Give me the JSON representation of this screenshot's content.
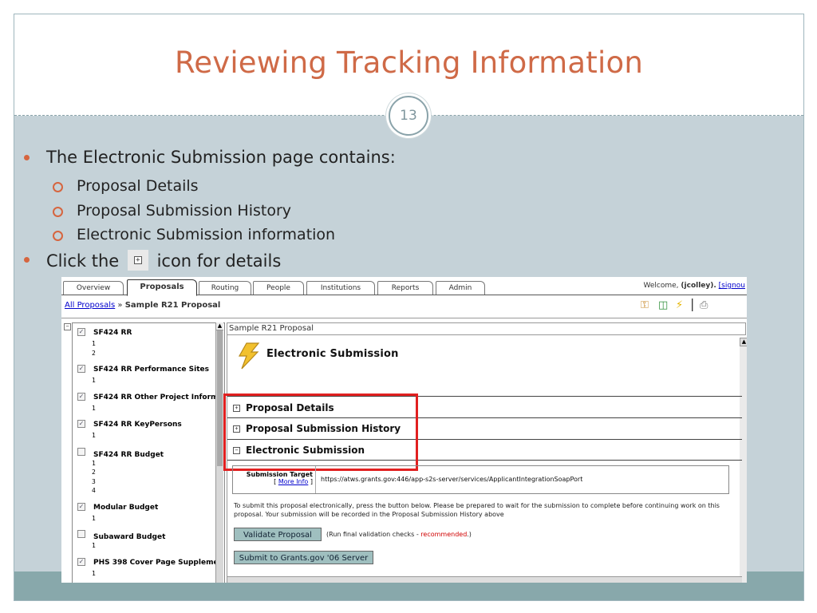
{
  "slide": {
    "title": "Reviewing Tracking Information",
    "number": "13",
    "bullets": [
      "The Electronic Submission page contains:",
      "Click the",
      "icon for details"
    ],
    "sub_bullets": [
      "Proposal Details",
      "Proposal Submission History",
      "Electronic Submission information"
    ],
    "colors": {
      "title": "#cf6a47",
      "bullet": "#d6653f",
      "footer": "#88a8ab",
      "body_bg": "#c5d2d8",
      "highlight": "#e12020"
    }
  },
  "app": {
    "tabs": [
      "Overview",
      "Proposals",
      "Routing",
      "People",
      "Institutions",
      "Reports",
      "Admin"
    ],
    "active_tab": "Proposals",
    "welcome_prefix": "Welcome, ",
    "user": "(jcolley).",
    "signout": "[signou",
    "breadcrumb": {
      "link": "All Proposals",
      "sep": "»",
      "current": "Sample R21 Proposal"
    },
    "toolbar_icons": [
      "key-icon",
      "document-arrow-icon",
      "bolt-icon",
      "print-icon"
    ]
  },
  "tree": {
    "items": [
      {
        "label": "SF424 RR",
        "checked": true,
        "subs": [
          "1",
          "2"
        ]
      },
      {
        "label": "SF424 RR Performance Sites",
        "checked": true,
        "subs": [
          "1"
        ]
      },
      {
        "label": "SF424 RR Other Project Inform",
        "checked": true,
        "subs": [
          "1"
        ]
      },
      {
        "label": "SF424 RR KeyPersons",
        "checked": true,
        "subs": [
          "1"
        ]
      },
      {
        "label": "SF424 RR Budget",
        "checked": false,
        "subs": [
          "1",
          "2",
          "3",
          "4"
        ]
      },
      {
        "label": "Modular Budget",
        "checked": true,
        "subs": [
          "1"
        ]
      },
      {
        "label": "Subaward Budget",
        "checked": false,
        "subs": [
          "1"
        ]
      },
      {
        "label": "PHS 398 Cover Page Supplemer",
        "checked": true,
        "subs": [
          "1"
        ]
      }
    ]
  },
  "panel": {
    "header": "Sample R21 Proposal",
    "title": "Electronic Submission",
    "sections": [
      "Proposal Details",
      "Proposal Submission History",
      "Electronic Submission"
    ],
    "target_label": "Submission Target",
    "more_info": "More Info",
    "target_url": "https://atws.grants.gov:446/app-s2s-server/services/ApplicantIntegrationSoapPort",
    "instructions": "To submit this proposal electronically, press the button below. Please be prepared to wait for the submission to complete before continuing work on this proposal. Your submission will be recorded in the Proposal Submission History above",
    "validate_button": "Validate Proposal",
    "validate_note": "(Run final validation checks - ",
    "validate_note_rec": "recommended",
    "validate_note_end": ".)",
    "submit_button": "Submit to Grants.gov '06 Server"
  }
}
